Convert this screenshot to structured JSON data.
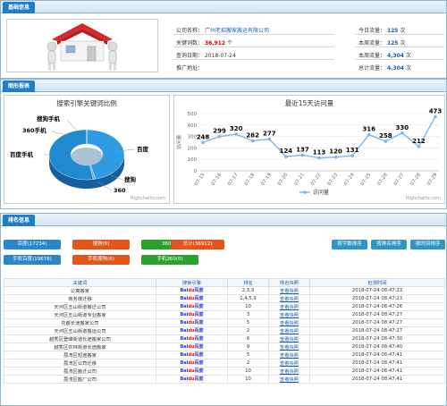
{
  "basic": {
    "tab": "基础信息",
    "company_label": "公司名称：",
    "company_value": "广州老招搬家搬运有限公司",
    "keywords_label": "关键词数：",
    "keywords_value": "36,912",
    "keywords_unit": "个",
    "date_label": "查询日期：",
    "date_value": "2018-07-24",
    "promo_label": "推广地址：",
    "today_label": "今日流量：",
    "today_value": "125",
    "week_label": "本周流量：",
    "week_value": "125",
    "month_label": "本周流量：",
    "month_value": "4,304",
    "total_label": "总计流量：",
    "total_value": "4,304",
    "unit": "次"
  },
  "charts": {
    "tab": "图形报表"
  },
  "chart_data": [
    {
      "type": "pie",
      "title": "搜索引擎关键词比例",
      "labels": [
        "百度",
        "搜狗",
        "360",
        "百度手机",
        "360手机",
        "搜狗手机"
      ],
      "values": [
        17234,
        6,
        360,
        19678,
        6,
        0.5
      ],
      "credit": "Highcharts.com"
    },
    {
      "type": "line",
      "title": "最近15天访问量",
      "x": [
        "07-15",
        "07-16",
        "07-17",
        "07-18",
        "07-19",
        "07-20",
        "07-21",
        "07-22",
        "07-23",
        "07-24",
        "07-25",
        "07-26",
        "07-27",
        "07-28",
        "07-29"
      ],
      "series": [
        {
          "name": "访问量",
          "values": [
            248,
            299,
            320,
            262,
            277,
            124,
            137,
            113,
            120,
            131,
            316,
            258,
            330,
            212,
            473
          ]
        }
      ],
      "ylabel": "访问量",
      "yticks": [
        0,
        100,
        200,
        300,
        400,
        500
      ],
      "ylim": [
        0,
        500
      ],
      "grid": true,
      "legend": "bottom",
      "credit": "Highcharts.com"
    }
  ],
  "rank": {
    "tab": "排名信息",
    "filters_row1": [
      {
        "label": "百度(17234)",
        "color": "blue"
      },
      {
        "label": "搜狗(6)",
        "color": "orange"
      },
      {
        "label": "360(0)",
        "color": "green"
      },
      {
        "label": "总计(36912)",
        "color": "orange"
      }
    ],
    "filters_row2": [
      {
        "label": "手机百度(19678)",
        "color": "blue"
      },
      {
        "label": "手机搜狗(6)",
        "color": "orange"
      },
      {
        "label": "手机360(0)",
        "color": "green"
      }
    ],
    "sort_buttons": [
      "按字数排序",
      "按排名排序",
      "按时间排序"
    ],
    "columns": [
      "关键词",
      "搜索引擎",
      "排名",
      "排名快照",
      "检测时间"
    ],
    "engine_text": [
      "Bai",
      "du",
      "百度"
    ],
    "rows": [
      {
        "keyword": "公寓搬家",
        "rank": "2,3,9",
        "snap": "查看快照",
        "time": "2018-07-24 08:47:23"
      },
      {
        "keyword": "商务楼迁移",
        "rank": "1,4,5,9",
        "snap": "查看快照",
        "time": "2018-07-24 08:47:23"
      },
      {
        "keyword": "天河区五山街道搬迁公司",
        "rank": "10",
        "snap": "查看快照",
        "time": "2018-07-24 08:47:26"
      },
      {
        "keyword": "天河区五山街道专业搬家",
        "rank": "3",
        "snap": "查看快照",
        "time": "2018-07-24 08:47:27"
      },
      {
        "keyword": "花都长途搬家公司",
        "rank": "5",
        "snap": "查看快照",
        "time": "2018-07-24 08:47:27"
      },
      {
        "keyword": "天河区五山街道搬运公司",
        "rank": "2",
        "snap": "查看快照",
        "time": "2018-07-24 08:47:27"
      },
      {
        "keyword": "越秀区登峰街道长途搬家公司",
        "rank": "6",
        "snap": "查看快照",
        "time": "2018-07-24 08:47:30"
      },
      {
        "keyword": "越秀区农林街道长途搬家",
        "rank": "9",
        "snap": "查看快照",
        "time": "2018-07-24 08:47:40"
      },
      {
        "keyword": "荔湾区短途搬家",
        "rank": "5",
        "snap": "查看快照",
        "time": "2018-07-24 08:47:41"
      },
      {
        "keyword": "荔湾区公司迁移",
        "rank": "2",
        "snap": "查看快照",
        "time": "2018-07-24 08:47:41"
      },
      {
        "keyword": "荔湾区搬迁公司",
        "rank": "10",
        "snap": "查看快照",
        "time": "2018-07-24 08:47:41"
      },
      {
        "keyword": "荔湾区搬厂公司",
        "rank": "10",
        "snap": "查看快照",
        "time": "2018-07-24 08:47:41"
      }
    ]
  }
}
